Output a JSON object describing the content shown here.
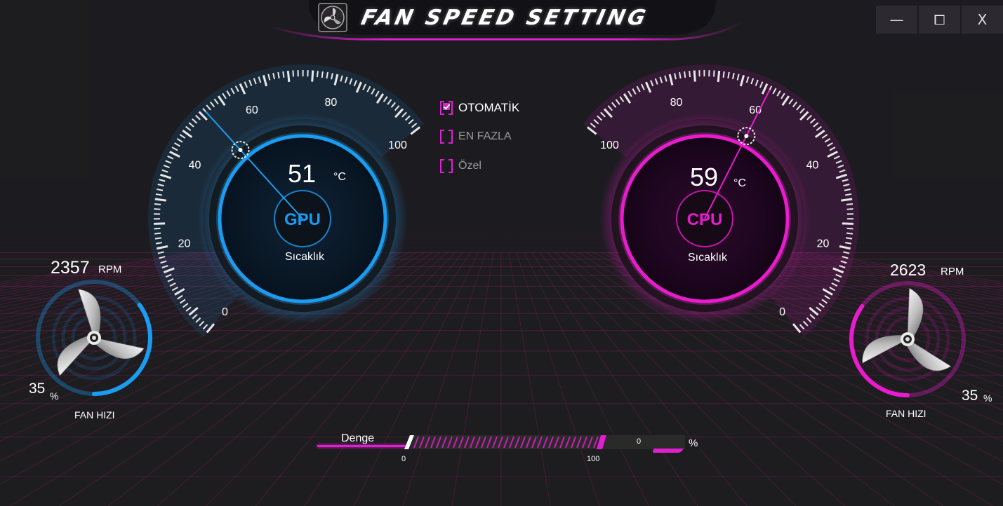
{
  "window": {
    "title": "FAN SPEED SETTING",
    "controls": {
      "minimize": "—",
      "maximize": "⧠",
      "close": "X"
    }
  },
  "colors": {
    "background": "#1d1c1f",
    "gpu_accent": "#1a9cf0",
    "cpu_accent": "#e81ccc",
    "grid": "#d0208e"
  },
  "gpu": {
    "chip_label": "GPU",
    "temperature": "51",
    "temperature_unit": "°C",
    "temperature_label": "Sıcaklık",
    "gauge_ticks": [
      "0",
      "20",
      "40",
      "60",
      "80",
      "100"
    ],
    "gauge_value": 51,
    "fan_rpm": "2357",
    "rpm_unit": "RPM",
    "fan_percent": "35",
    "fan_percent_value": 35,
    "percent_unit": "%",
    "fan_label": "FAN HIZI"
  },
  "cpu": {
    "chip_label": "CPU",
    "temperature": "59",
    "temperature_unit": "°C",
    "temperature_label": "Sıcaklık",
    "gauge_ticks": [
      "0",
      "20",
      "40",
      "60",
      "80",
      "100"
    ],
    "gauge_value": 59,
    "fan_rpm": "2623",
    "rpm_unit": "RPM",
    "fan_percent": "35",
    "fan_percent_value": 35,
    "percent_unit": "%",
    "fan_label": "FAN HIZI"
  },
  "modes": [
    {
      "label": "OTOMATİK",
      "checked": true
    },
    {
      "label": "EN FAZLA",
      "checked": false
    },
    {
      "label": "Özel",
      "checked": false
    }
  ],
  "slider": {
    "label": "Denge",
    "min_label": "0",
    "max_label": "100",
    "value": "0",
    "unit": "%",
    "fill_fraction": 0.7
  }
}
